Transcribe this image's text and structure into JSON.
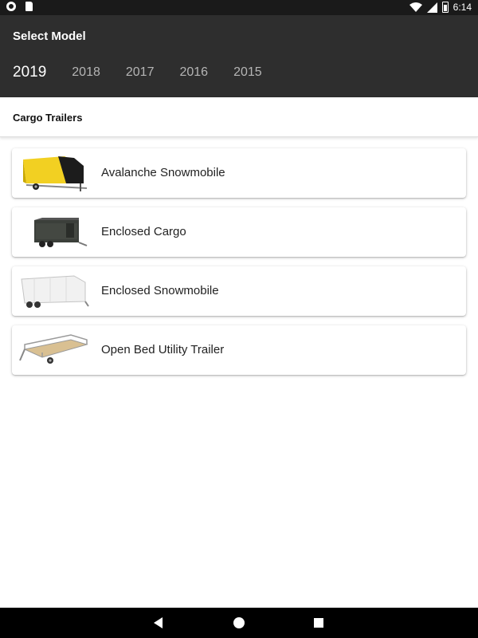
{
  "status_bar": {
    "time": "6:14",
    "icons": [
      "record-icon",
      "sd-card-icon",
      "wifi-icon",
      "signal-icon",
      "battery-icon"
    ]
  },
  "app_bar": {
    "title": "Select Model",
    "background": "#2e2e2e",
    "years": [
      "2019",
      "2018",
      "2017",
      "2016",
      "2015"
    ],
    "selected_year": "2019"
  },
  "section": {
    "title": "Cargo Trailers"
  },
  "models": [
    {
      "label": "Avalanche Snowmobile",
      "image": "yellow-black-trailer-image"
    },
    {
      "label": "Enclosed Cargo",
      "image": "dark-enclosed-trailer-image"
    },
    {
      "label": "Enclosed Snowmobile",
      "image": "white-enclosed-trailer-image"
    },
    {
      "label": "Open Bed Utility Trailer",
      "image": "open-bed-trailer-image"
    }
  ],
  "nav_bar": {
    "icons": [
      "back-icon",
      "home-icon",
      "recents-icon"
    ]
  }
}
